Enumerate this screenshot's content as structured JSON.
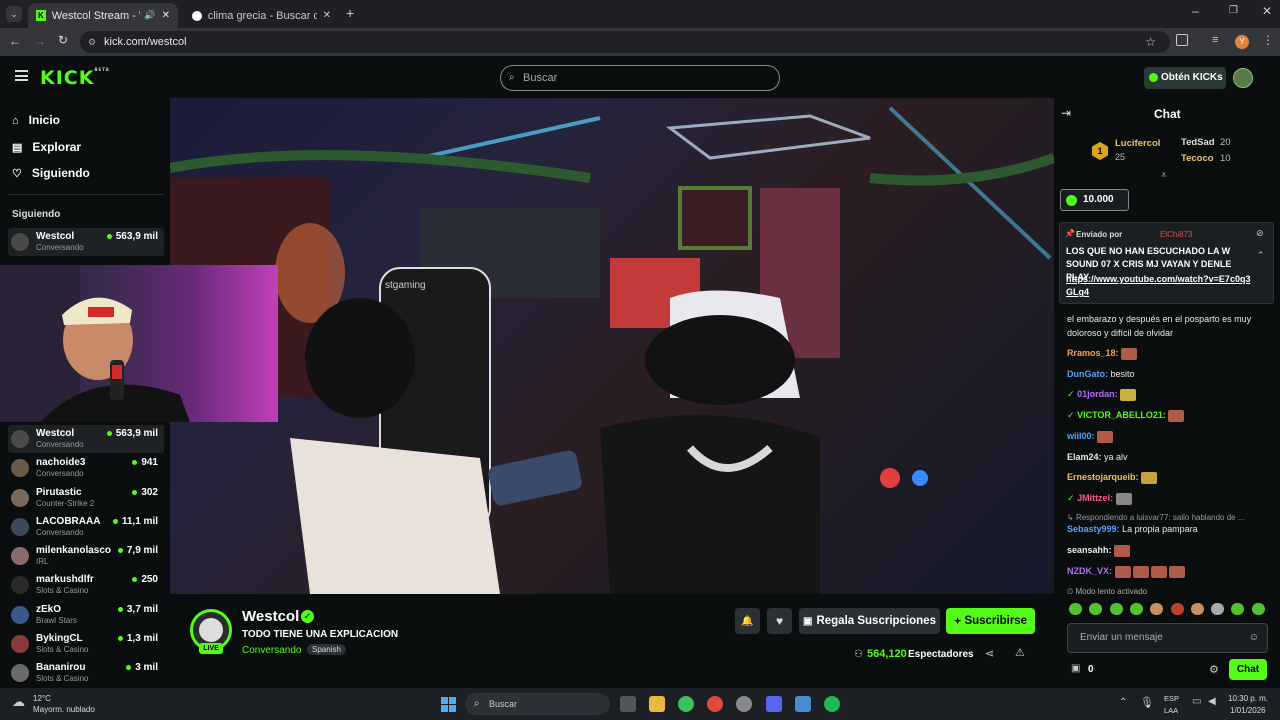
{
  "browser": {
    "tabs": [
      {
        "title": "Westcol Stream - Watch Liv",
        "active": true
      },
      {
        "title": "clima grecia - Buscar con Goog",
        "active": false
      }
    ],
    "url": "kick.com/westcol",
    "profile_initial": "Y"
  },
  "header": {
    "logo": "KICK",
    "logo_badge": "BETA",
    "search_placeholder": "Buscar",
    "get_kicks": "Obtén KICKs"
  },
  "sidebar": {
    "nav": [
      "Inicio",
      "Explorar",
      "Siguiendo"
    ],
    "section_title": "Siguiendo",
    "top_channel": {
      "name": "Westcol",
      "category": "Conversando",
      "viewers": "563,9 mil"
    },
    "channels": [
      {
        "name": "Westcol",
        "category": "Conversando",
        "viewers": "563,9 mil"
      },
      {
        "name": "nachoide3",
        "category": "Conversando",
        "viewers": "941"
      },
      {
        "name": "Pirutastic",
        "category": "Counter-Strike 2",
        "viewers": "302"
      },
      {
        "name": "LACOBRAAA",
        "category": "Conversando",
        "viewers": "11,1 mil"
      },
      {
        "name": "milenkanolasco",
        "category": "IRL",
        "viewers": "7,9 mil"
      },
      {
        "name": "markushdlfr",
        "category": "Slots & Casino",
        "viewers": "250"
      },
      {
        "name": "zEkO",
        "category": "Brawl Stars",
        "viewers": "3,7 mil"
      },
      {
        "name": "BykingCL",
        "category": "Slots & Casino",
        "viewers": "1,3 mil"
      },
      {
        "name": "Bananirou",
        "category": "Slots & Casino",
        "viewers": "3 mil"
      }
    ]
  },
  "stream": {
    "channel": "Westcol",
    "live_badge": "LIVE",
    "title": "TODO TIENE UNA EXPLICACION",
    "category": "Conversando",
    "language": "Spanish",
    "gift_subs": "Regala Suscripciones",
    "subscribe": "Suscribirse",
    "viewers": "564,120",
    "viewers_label": "Espectadores"
  },
  "chat": {
    "title": "Chat",
    "leaderboard": [
      {
        "rank": "1",
        "name": "Lucifercol",
        "value": "25"
      },
      {
        "name": "TedSad",
        "value": "20"
      },
      {
        "name": "Tecoco",
        "value": "10"
      }
    ],
    "goal_value": "10.000",
    "pinned": {
      "label": "Enviado por",
      "user": "ElChi873",
      "text": "LOS QUE NO HAN ESCUCHADO LA W SOUND 07 X CRIS MJ VAYAN Y DENLE PLAY",
      "link": "https://www.youtube.com/watch?v=E7c0q3GLg4"
    },
    "cut_message": "el embarazo y después en el posparto es muy doloroso y difícil de olvidar",
    "messages": [
      {
        "user": "Rramos_18:",
        "text": "",
        "color": "#f0a05a",
        "emote": true
      },
      {
        "user": "DunGato:",
        "text": "besito",
        "color": "#5aa0f0",
        "emote": false
      },
      {
        "user": "01jordan:",
        "text": "",
        "color": "#b070f0",
        "emote": true
      },
      {
        "user": "VICTOR_ABELLO21:",
        "text": "",
        "color": "#53fc18",
        "emote": true
      },
      {
        "user": "wiil00:",
        "text": "",
        "color": "#5aa0f0",
        "emote": true
      },
      {
        "user": "Elam24:",
        "text": "ya alv",
        "color": "#e8e8e8",
        "emote": false
      },
      {
        "user": "Ernestojarqueib:",
        "text": "",
        "color": "#f0c05a",
        "emote": true
      },
      {
        "user": "JMittzel:",
        "text": "",
        "color": "#f05a8a",
        "emote": true
      }
    ],
    "reply_note": "Respondiendo a luisvar77: salio hablando de ...",
    "reply_msg": {
      "user": "Sebasty999:",
      "text": "La propia pampara",
      "color": "#5aa0f0"
    },
    "messages2": [
      {
        "user": "seansahh:",
        "color": "#e8e8e8"
      },
      {
        "user": "NZDK_VX:",
        "color": "#b070f0"
      }
    ],
    "slow_mode": "Modo lento activado",
    "input_placeholder": "Enviar un mensaje",
    "points": "0",
    "send": "Chat"
  },
  "taskbar": {
    "weather_temp": "12°C",
    "weather_desc": "Mayorm. nublado",
    "search": "Buscar",
    "lang1": "ESP",
    "lang2": "LAA",
    "time": "10:30 p. m.",
    "date": "1/01/2026"
  }
}
